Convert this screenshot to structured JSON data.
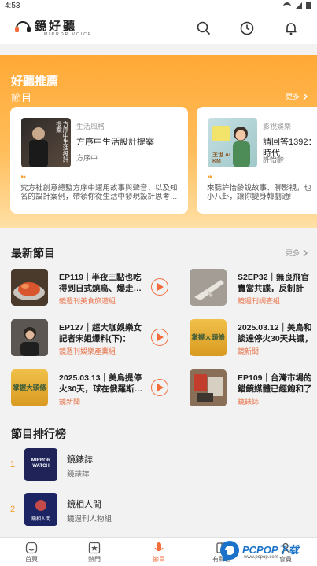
{
  "status_bar": {
    "time": "4:53"
  },
  "app": {
    "logo_text": "鏡好聽",
    "logo_sub": "MIRROR VOICE"
  },
  "featured": {
    "title": "好聽推薦",
    "subtitle": "節目",
    "more_label": "更多",
    "cards": [
      {
        "category": "生活風格",
        "title": "方序中生活設計提案",
        "host": "方序中",
        "cover_text": "方序中生活設計提案",
        "desc": "究方社創意總監方序中運用故事與聲音，以及知名的設計案例，帶領你從生活中發現設計思考…"
      },
      {
        "category": "影視娛樂",
        "title": "請回答1392：時代",
        "host": "許怡齡",
        "cover_text": "王世 AI KM",
        "desc": "來聽許怡齡說故事、聊影視，也小八卦，讓你變身韓劇通!"
      }
    ]
  },
  "latest": {
    "title": "最新節目",
    "more_label": "更多",
    "episodes": [
      {
        "title": "EP119｜半夜三點也吃得到日式燒鳥、爆走…",
        "source": "鏡週刊美食旅遊組"
      },
      {
        "title": "S2EP32｜無良飛官賣當共諜，反制計畫、…",
        "source": "鏡週刊調查組"
      },
      {
        "title": "EP127｜超大咖娛樂女記者宋姐爆料(下)：追…",
        "source": "鏡週刊娛樂產業組"
      },
      {
        "title": "2025.03.12｜美烏和談達停火30天共識，待…",
        "source": "鏡新聞",
        "cover_text": "掌握大頭條"
      },
      {
        "title": "2025.03.13｜美烏提停火30天，球在俄羅斯…",
        "source": "鏡新聞",
        "cover_text": "掌握大頭條"
      },
      {
        "title": "EP109｜台灣市場的錯鏡媒體已經飽和了嗎…",
        "source": "鏡錶誌"
      }
    ]
  },
  "ranking": {
    "title": "節目排行榜",
    "items": [
      {
        "rank": "1",
        "title": "鏡錶誌",
        "sub": "鏡錶誌",
        "cover_text": "MIRROR WATCH"
      },
      {
        "rank": "2",
        "title": "鏡相人間",
        "sub": "鏡週刊人物組",
        "cover_text": "鏡相人間"
      }
    ]
  },
  "bottom_nav": {
    "items": [
      {
        "label": "首頁",
        "icon": "home-icon"
      },
      {
        "label": "熱門",
        "icon": "star-icon"
      },
      {
        "label": "節目",
        "icon": "mic-icon",
        "active": true
      },
      {
        "label": "有聲書",
        "icon": "book-icon"
      },
      {
        "label": "會員",
        "icon": "user-icon"
      }
    ]
  },
  "watermark": {
    "text": "PCPOP下载",
    "sub": "www.pcpop.com"
  },
  "colors": {
    "accent": "#f26c3a",
    "orange": "#ffa936",
    "source": "#e8734a",
    "rank": "#f2a031"
  }
}
